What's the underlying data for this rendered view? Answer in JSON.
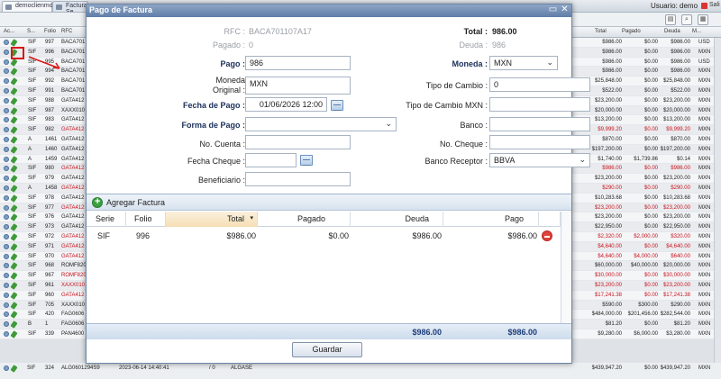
{
  "app": {
    "tabs": [
      {
        "label": "democlienmo2"
      },
      {
        "label": "Facturas Se..."
      }
    ],
    "user_label": "Usuario: demo",
    "exit_label": "Sali"
  },
  "grid": {
    "headers": [
      "Ac...",
      "S...",
      "Folio",
      "RFC",
      "Total",
      "Pagado",
      "Deuda",
      "M..."
    ],
    "rows": [
      {
        "s": "SIF",
        "folio": "997",
        "rfc": "BACA701",
        "total": "$986.00",
        "pagado": "$0.00",
        "deuda": "$986.00",
        "m": "USD",
        "red": false
      },
      {
        "s": "SIF",
        "folio": "996",
        "rfc": "BACA701",
        "total": "$986.00",
        "pagado": "$0.00",
        "deuda": "$986.00",
        "m": "MXN",
        "red": false
      },
      {
        "s": "SIF",
        "folio": "995",
        "rfc": "BACA701",
        "total": "$986.00",
        "pagado": "$0.00",
        "deuda": "$986.00",
        "m": "USD",
        "red": false
      },
      {
        "s": "SIF",
        "folio": "994",
        "rfc": "BACA701",
        "total": "$986.00",
        "pagado": "$0.00",
        "deuda": "$986.00",
        "m": "MXN",
        "red": false
      },
      {
        "s": "SIF",
        "folio": "992",
        "rfc": "BACA701",
        "total": "$25,848.00",
        "pagado": "$0.00",
        "deuda": "$25,848.00",
        "m": "MXN",
        "red": false
      },
      {
        "s": "SIF",
        "folio": "991",
        "rfc": "BACA701",
        "total": "$522.00",
        "pagado": "$0.00",
        "deuda": "$522.00",
        "m": "MXN",
        "red": false
      },
      {
        "s": "SIF",
        "folio": "988",
        "rfc": "GATA412",
        "total": "$23,200.00",
        "pagado": "$0.00",
        "deuda": "$23,200.00",
        "m": "MXN",
        "red": false
      },
      {
        "s": "SIF",
        "folio": "987",
        "rfc": "XAXX010",
        "total": "$20,000.00",
        "pagado": "$0.00",
        "deuda": "$20,000.00",
        "m": "MXN",
        "red": false
      },
      {
        "s": "SIF",
        "folio": "983",
        "rfc": "GATA412",
        "total": "$13,200.00",
        "pagado": "$0.00",
        "deuda": "$13,200.00",
        "m": "MXN",
        "red": false
      },
      {
        "s": "SIF",
        "folio": "982",
        "rfc": "GATA412",
        "total": "$9,999.20",
        "pagado": "$0.00",
        "deuda": "$9,999.20",
        "m": "MXN",
        "red": true
      },
      {
        "s": "A",
        "folio": "1461",
        "rfc": "GATA412",
        "total": "$870.00",
        "pagado": "$0.00",
        "deuda": "$870.00",
        "m": "MXN",
        "red": false
      },
      {
        "s": "A",
        "folio": "1460",
        "rfc": "GATA412",
        "total": "$197,200.00",
        "pagado": "$0.00",
        "deuda": "$197,200.00",
        "m": "MXN",
        "red": false
      },
      {
        "s": "A",
        "folio": "1459",
        "rfc": "GATA412",
        "total": "$1,740.00",
        "pagado": "$1,739.86",
        "deuda": "$0.14",
        "m": "MXN",
        "red": false
      },
      {
        "s": "SIF",
        "folio": "980",
        "rfc": "GATA412",
        "total": "$986.00",
        "pagado": "$0.00",
        "deuda": "$986.00",
        "m": "MXN",
        "red": true
      },
      {
        "s": "SIF",
        "folio": "979",
        "rfc": "GATA412",
        "total": "$23,200.00",
        "pagado": "$0.00",
        "deuda": "$23,200.00",
        "m": "MXN",
        "red": false
      },
      {
        "s": "A",
        "folio": "1458",
        "rfc": "GATA412",
        "total": "$290.00",
        "pagado": "$0.00",
        "deuda": "$290.00",
        "m": "MXN",
        "red": true
      },
      {
        "s": "SIF",
        "folio": "978",
        "rfc": "GATA412",
        "total": "$10,283.68",
        "pagado": "$0.00",
        "deuda": "$10,283.68",
        "m": "MXN",
        "red": false
      },
      {
        "s": "SIF",
        "folio": "977",
        "rfc": "GATA412",
        "total": "$23,200.00",
        "pagado": "$0.00",
        "deuda": "$23,200.00",
        "m": "MXN",
        "red": true
      },
      {
        "s": "SIF",
        "folio": "976",
        "rfc": "GATA412",
        "total": "$23,200.00",
        "pagado": "$0.00",
        "deuda": "$23,200.00",
        "m": "MXN",
        "red": false
      },
      {
        "s": "SIF",
        "folio": "973",
        "rfc": "GATA412",
        "total": "$22,950.00",
        "pagado": "$0.00",
        "deuda": "$22,950.00",
        "m": "MXN",
        "red": false
      },
      {
        "s": "SIF",
        "folio": "972",
        "rfc": "GATA412",
        "total": "$2,320.00",
        "pagado": "$2,000.00",
        "deuda": "$320.00",
        "m": "MXN",
        "red": true
      },
      {
        "s": "SIF",
        "folio": "971",
        "rfc": "GATA412",
        "total": "$4,640.00",
        "pagado": "$0.00",
        "deuda": "$4,640.00",
        "m": "MXN",
        "red": true
      },
      {
        "s": "SIF",
        "folio": "970",
        "rfc": "GATA412",
        "total": "$4,640.00",
        "pagado": "$4,000.00",
        "deuda": "$640.00",
        "m": "MXN",
        "red": true
      },
      {
        "s": "SIF",
        "folio": "968",
        "rfc": "ROMF820",
        "total": "$60,000.00",
        "pagado": "$40,000.00",
        "deuda": "$20,000.00",
        "m": "MXN",
        "red": false
      },
      {
        "s": "SIF",
        "folio": "967",
        "rfc": "ROMF820",
        "total": "$30,000.00",
        "pagado": "$0.00",
        "deuda": "$30,000.00",
        "m": "MXN",
        "red": true
      },
      {
        "s": "SIF",
        "folio": "961",
        "rfc": "XAXX010",
        "total": "$23,200.00",
        "pagado": "$0.00",
        "deuda": "$23,200.00",
        "m": "MXN",
        "red": true
      },
      {
        "s": "SIF",
        "folio": "960",
        "rfc": "GATA412",
        "total": "$17,241.38",
        "pagado": "$0.00",
        "deuda": "$17,241.38",
        "m": "MXN",
        "red": true
      },
      {
        "s": "SIF",
        "folio": "705",
        "rfc": "XAXX010",
        "total": "$590.00",
        "pagado": "$300.00",
        "deuda": "$290.00",
        "m": "MXN",
        "red": false
      },
      {
        "s": "SIF",
        "folio": "420",
        "rfc": "FAG0606",
        "total": "$484,000.00",
        "pagado": "$201,456.00",
        "deuda": "$282,544.00",
        "m": "MXN",
        "red": false
      },
      {
        "s": "B",
        "folio": "1",
        "rfc": "FAG0606",
        "total": "$81.20",
        "pagado": "$0.00",
        "deuda": "$81.20",
        "m": "MXN",
        "red": false
      },
      {
        "s": "SIF",
        "folio": "339",
        "rfc": "PAN4600",
        "total": "$9,280.00",
        "pagado": "$6,000.00",
        "deuda": "$3,280.00",
        "m": "MXN",
        "red": false
      }
    ],
    "bottom_row": {
      "s": "SIF",
      "folio": "324",
      "rfc": "ALG0601294S9",
      "date": "2023-06-14 14:40:41",
      "extra": "/ 0",
      "name": "ALGASE",
      "total": "$439,947.20",
      "pagado": "$0.00",
      "deuda": "$439,947.20",
      "m": "MXN"
    }
  },
  "dialog": {
    "title": "Pago de Factura",
    "rfc_label": "RFC :",
    "rfc_value": "BACA701107A17",
    "pagado_label": "Pagado :",
    "pagado_value": "0",
    "pago_label": "Pago :",
    "pago_value": "986",
    "moneda_original_label": "Moneda Original :",
    "moneda_original_value": "MXN",
    "fecha_pago_label": "Fecha de Pago :",
    "fecha_pago_value": "01/06/2026 12:00",
    "forma_pago_label": "Forma de Pago :",
    "forma_pago_value": "",
    "no_cuenta_label": "No. Cuenta :",
    "no_cuenta_value": "",
    "fecha_cheque_label": "Fecha Cheque :",
    "fecha_cheque_value": "",
    "beneficiario_label": "Beneficiario :",
    "beneficiario_value": "",
    "total_label": "Total :",
    "total_value": "986.00",
    "deuda_label": "Deuda :",
    "deuda_value": "986",
    "moneda_label": "Moneda :",
    "moneda_value": "MXN",
    "tipo_cambio_label": "Tipo de Cambio :",
    "tipo_cambio_value": "0",
    "tipo_cambio_mxn_label": "Tipo de Cambio MXN :",
    "tipo_cambio_mxn_value": "",
    "banco_label": "Banco :",
    "banco_value": "",
    "no_cheque_label": "No. Cheque :",
    "no_cheque_value": "",
    "banco_receptor_label": "Banco Receptor :",
    "banco_receptor_value": "BBVA",
    "add_invoice_label": "Agregar Factura",
    "invoice_headers": {
      "serie": "Serie",
      "folio": "Folio",
      "total": "Total",
      "pagado": "Pagado",
      "deuda": "Deuda",
      "pago": "Pago"
    },
    "invoice_row": {
      "serie": "SIF",
      "folio": "996",
      "total": "$986.00",
      "pagado": "$0.00",
      "deuda": "$986.00",
      "pago": "$986.00"
    },
    "footer_deuda": "$986.00",
    "footer_pago": "$986.00",
    "save_label": "Guardar"
  }
}
